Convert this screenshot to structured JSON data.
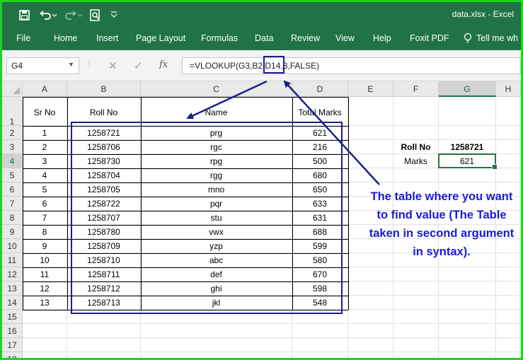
{
  "window": {
    "title": "data.xlsx  -  Excel"
  },
  "quick_access": {
    "save_icon": "save-icon",
    "undo_icon": "undo-icon",
    "redo_icon": "redo-icon",
    "preview_icon": "print-preview-icon",
    "customize_icon": "chevron-down-icon"
  },
  "ribbon": {
    "tabs": [
      "File",
      "Home",
      "Insert",
      "Page Layout",
      "Formulas",
      "Data",
      "Review",
      "View",
      "Help",
      "Foxit PDF"
    ],
    "tell_me": "Tell me wh"
  },
  "formula_bar": {
    "name_box": "G4",
    "cancel_icon": "✕",
    "enter_icon": "✓",
    "fx_icon": "fx",
    "formula": "=VLOOKUP(G3,B2:D14,3,FALSE)"
  },
  "columns": [
    "A",
    "B",
    "C",
    "D",
    "E",
    "F",
    "G",
    "H"
  ],
  "rows": [
    "1",
    "2",
    "3",
    "4",
    "5",
    "6",
    "7",
    "8",
    "9",
    "10",
    "11",
    "12",
    "13",
    "14",
    "15",
    "16",
    "17",
    "18"
  ],
  "table": {
    "headers": [
      "Sr No",
      "Roll No",
      "Name",
      "Total Marks"
    ],
    "rows": [
      [
        "1",
        "1258721",
        "prg",
        "621"
      ],
      [
        "2",
        "1258706",
        "rgc",
        "216"
      ],
      [
        "3",
        "1258730",
        "rpg",
        "500"
      ],
      [
        "4",
        "1258704",
        "rgg",
        "680"
      ],
      [
        "5",
        "1258705",
        "mno",
        "650"
      ],
      [
        "6",
        "1258722",
        "pqr",
        "633"
      ],
      [
        "7",
        "1258707",
        "stu",
        "631"
      ],
      [
        "8",
        "1258780",
        "vwx",
        "688"
      ],
      [
        "9",
        "1258709",
        "yzp",
        "599"
      ],
      [
        "10",
        "1258710",
        "abc",
        "580"
      ],
      [
        "11",
        "1258711",
        "def",
        "670"
      ],
      [
        "12",
        "1258712",
        "ghi",
        "598"
      ],
      [
        "13",
        "1258713",
        "jkl",
        "548"
      ]
    ]
  },
  "lookup": {
    "roll_label": "Roll No",
    "roll_value": "1258721",
    "marks_label": "Marks",
    "marks_value": "621"
  },
  "annotation": "The table where you want to find value (The Table taken in second argument in syntax).",
  "colors": {
    "excel_green": "#217346",
    "frame_green": "#1fd41f",
    "annotation_blue": "#1b1bd8",
    "box_navy": "#1e1e8c"
  }
}
